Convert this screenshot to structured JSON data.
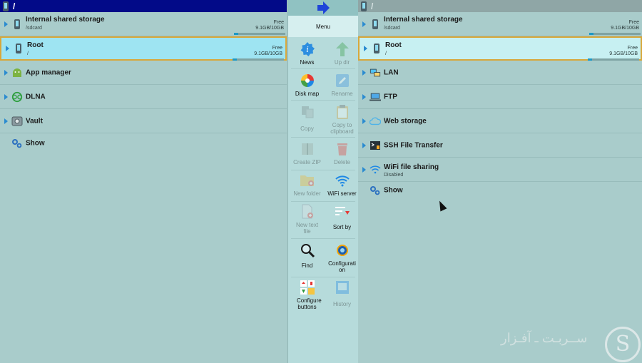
{
  "left": {
    "header_path": "/",
    "storage_rows": [
      {
        "title": "Internal shared storage",
        "sub": "/sdcard",
        "free_label": "Free",
        "size": "9.1GB/10GB",
        "used_fraction": 0.09,
        "selected": false
      },
      {
        "title": "Root",
        "sub": "/",
        "free_label": "Free",
        "size": "9.1GB/10GB",
        "used_fraction": 0.09,
        "selected": true
      }
    ],
    "items": [
      {
        "title": "App manager",
        "icon": "android-icon"
      },
      {
        "title": "DLNA",
        "icon": "dlna-icon"
      },
      {
        "title": "Vault",
        "icon": "vault-icon"
      },
      {
        "title": "Show",
        "icon": "gears-icon"
      }
    ]
  },
  "right": {
    "header_path": "/",
    "storage_rows": [
      {
        "title": "Internal shared storage",
        "sub": "/sdcard",
        "free_label": "Free",
        "size": "9.1GB/10GB",
        "used_fraction": 0.09,
        "selected": false
      },
      {
        "title": "Root",
        "sub": "/",
        "free_label": "Free",
        "size": "9.1GB/10GB",
        "used_fraction": 0.09,
        "selected": true
      }
    ],
    "items": [
      {
        "title": "LAN",
        "icon": "lan-icon"
      },
      {
        "title": "FTP",
        "icon": "ftp-icon"
      },
      {
        "title": "Web storage",
        "icon": "cloud-icon"
      },
      {
        "title": "SSH File Transfer",
        "icon": "ssh-icon"
      },
      {
        "title": "WiFi file sharing",
        "sub": "Disabled",
        "icon": "wifi-icon"
      },
      {
        "title": "Show",
        "icon": "gears-icon"
      }
    ]
  },
  "menu": {
    "title": "Menu",
    "buttons": [
      {
        "label": "News",
        "icon": "info-icon",
        "enabled": true
      },
      {
        "label": "Up dir",
        "icon": "up-arrow-icon",
        "enabled": false
      },
      {
        "label": "Disk map",
        "icon": "pie-chart-icon",
        "enabled": true
      },
      {
        "label": "Rename",
        "icon": "pencil-icon",
        "enabled": false
      },
      {
        "label": "Copy",
        "icon": "copy-icon",
        "enabled": false
      },
      {
        "label": "Copy to clipboard",
        "icon": "clipboard-icon",
        "enabled": false
      },
      {
        "label": "Create ZIP",
        "icon": "zip-icon",
        "enabled": false
      },
      {
        "label": "Delete",
        "icon": "trash-icon",
        "enabled": false
      },
      {
        "label": "New folder",
        "icon": "new-folder-icon",
        "enabled": false
      },
      {
        "label": "WiFi server",
        "icon": "wifi-icon",
        "enabled": true
      },
      {
        "label": "New text file",
        "icon": "new-file-icon",
        "enabled": false
      },
      {
        "label": "Sort by",
        "icon": "sort-icon",
        "enabled": true
      },
      {
        "label": "Find",
        "icon": "magnifier-icon",
        "enabled": true
      },
      {
        "label": "Configuration",
        "icon": "gear-icon",
        "enabled": true
      },
      {
        "label": "Configure buttons",
        "icon": "configure-buttons-icon",
        "enabled": true
      },
      {
        "label": "History",
        "icon": "history-icon",
        "enabled": false
      }
    ]
  },
  "watermark": {
    "letter": "S",
    "text": "ســربـت ـ آفـزار"
  },
  "colors": {
    "left_header": "#020a88",
    "selection": "#9ee4f2",
    "selection_border": "#d8a73a",
    "accent": "#1e98c4",
    "background": "#a9cccb"
  }
}
